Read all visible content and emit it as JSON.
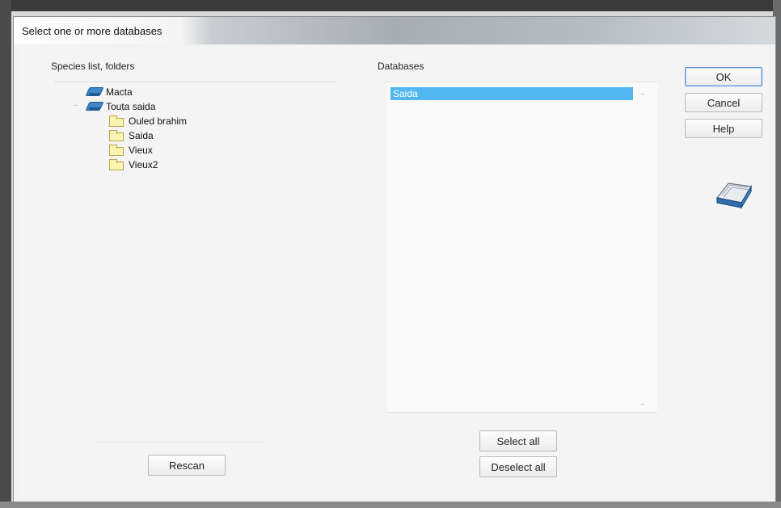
{
  "dialog": {
    "title": "Select one or more databases"
  },
  "left_panel": {
    "label": "Species list, folders",
    "tree": [
      {
        "label": "Macta",
        "icon": "database-icon",
        "level": 0
      },
      {
        "label": "Touta saida",
        "icon": "database-icon",
        "level": 0,
        "expanded": true
      },
      {
        "label": "Ouled brahim",
        "icon": "folder-icon",
        "level": 1
      },
      {
        "label": "Saida",
        "icon": "folder-icon",
        "level": 1
      },
      {
        "label": "Vieux",
        "icon": "folder-icon",
        "level": 1
      },
      {
        "label": "Vieux2",
        "icon": "folder-icon",
        "level": 1
      }
    ],
    "rescan_label": "Rescan"
  },
  "right_panel": {
    "label": "Databases",
    "items": [
      {
        "label": "Saida",
        "selected": true
      }
    ],
    "select_all_label": "Select all",
    "deselect_all_label": "Deselect all"
  },
  "buttons": {
    "ok_label": "OK",
    "cancel_label": "Cancel",
    "help_label": "Help"
  },
  "colors": {
    "selection": "#52b6f0",
    "database_icon": "#3d86c6"
  }
}
